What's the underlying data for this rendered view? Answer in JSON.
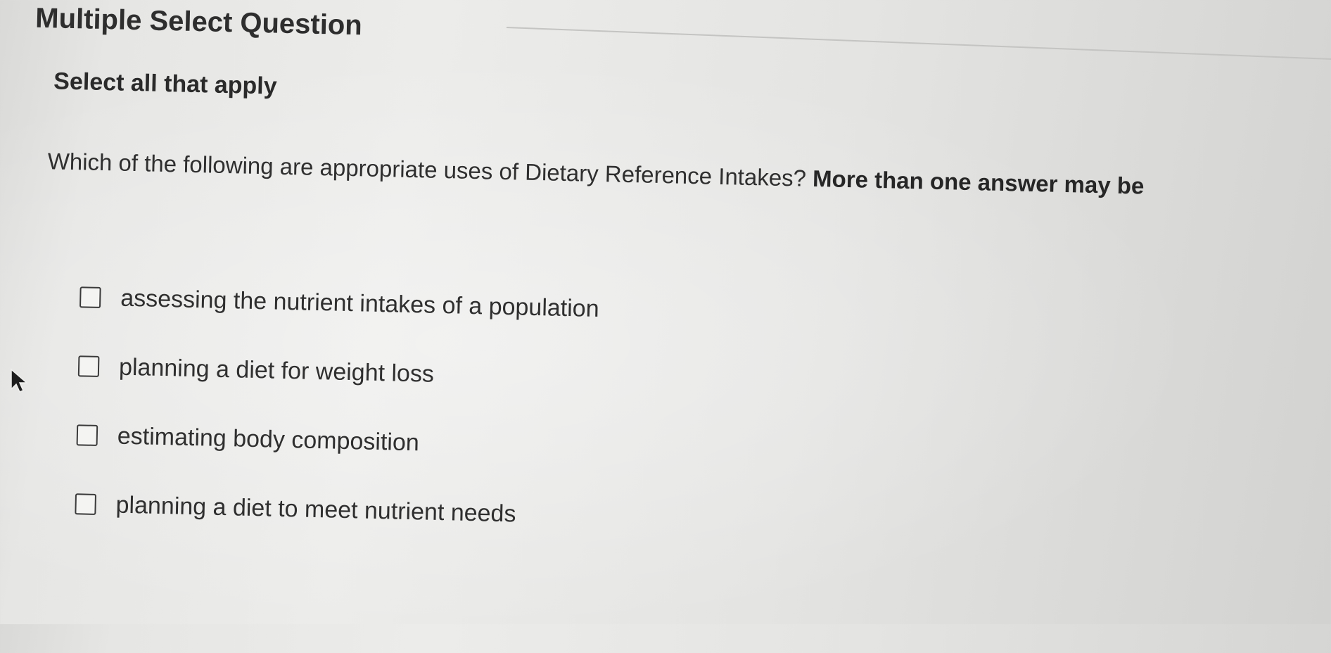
{
  "question": {
    "type_label": "Multiple Select Question",
    "instructions": "Select all that apply",
    "prompt": "Which of the following are appropriate uses of Dietary Reference Intakes?",
    "prompt_emphasis": "More than one answer may be"
  },
  "options": [
    {
      "label": "assessing the nutrient intakes of a population",
      "checked": false
    },
    {
      "label": "planning a diet for weight loss",
      "checked": false
    },
    {
      "label": "estimating body composition",
      "checked": false
    },
    {
      "label": "planning a diet to meet nutrient needs",
      "checked": false
    }
  ],
  "icons": {
    "cursor": "mouse-pointer-icon"
  },
  "colors": {
    "text": "#2f2f2f",
    "background": "#e6e6e4"
  }
}
